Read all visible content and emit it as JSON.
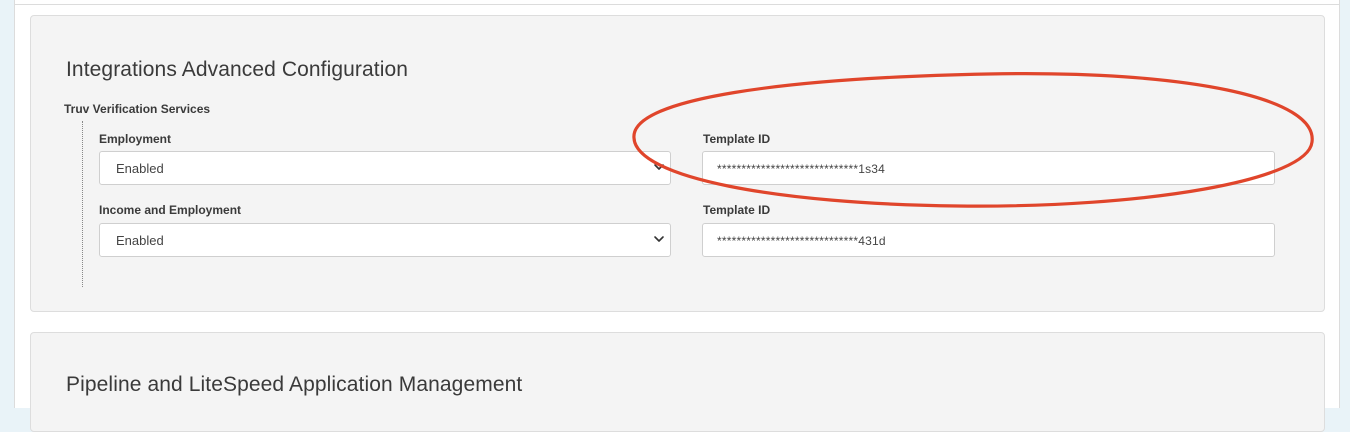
{
  "integrations": {
    "title": "Integrations Advanced Configuration",
    "section_label": "Truv Verification Services",
    "rows": [
      {
        "select_label": "Employment",
        "select_value": "Enabled",
        "template_label": "Template ID",
        "template_value": "*****************************1s34"
      },
      {
        "select_label": "Income and Employment",
        "select_value": "Enabled",
        "template_label": "Template ID",
        "template_value": "*****************************431d"
      }
    ]
  },
  "pipeline": {
    "title": "Pipeline and LiteSpeed Application Management"
  },
  "icons": {
    "select_chevron": "chevron-down-icon",
    "highlight": "red-ellipse-annotation"
  },
  "colors": {
    "page_background": "#e9f3f8",
    "card_background": "#f4f4f4",
    "annotation": "#e0452b"
  }
}
